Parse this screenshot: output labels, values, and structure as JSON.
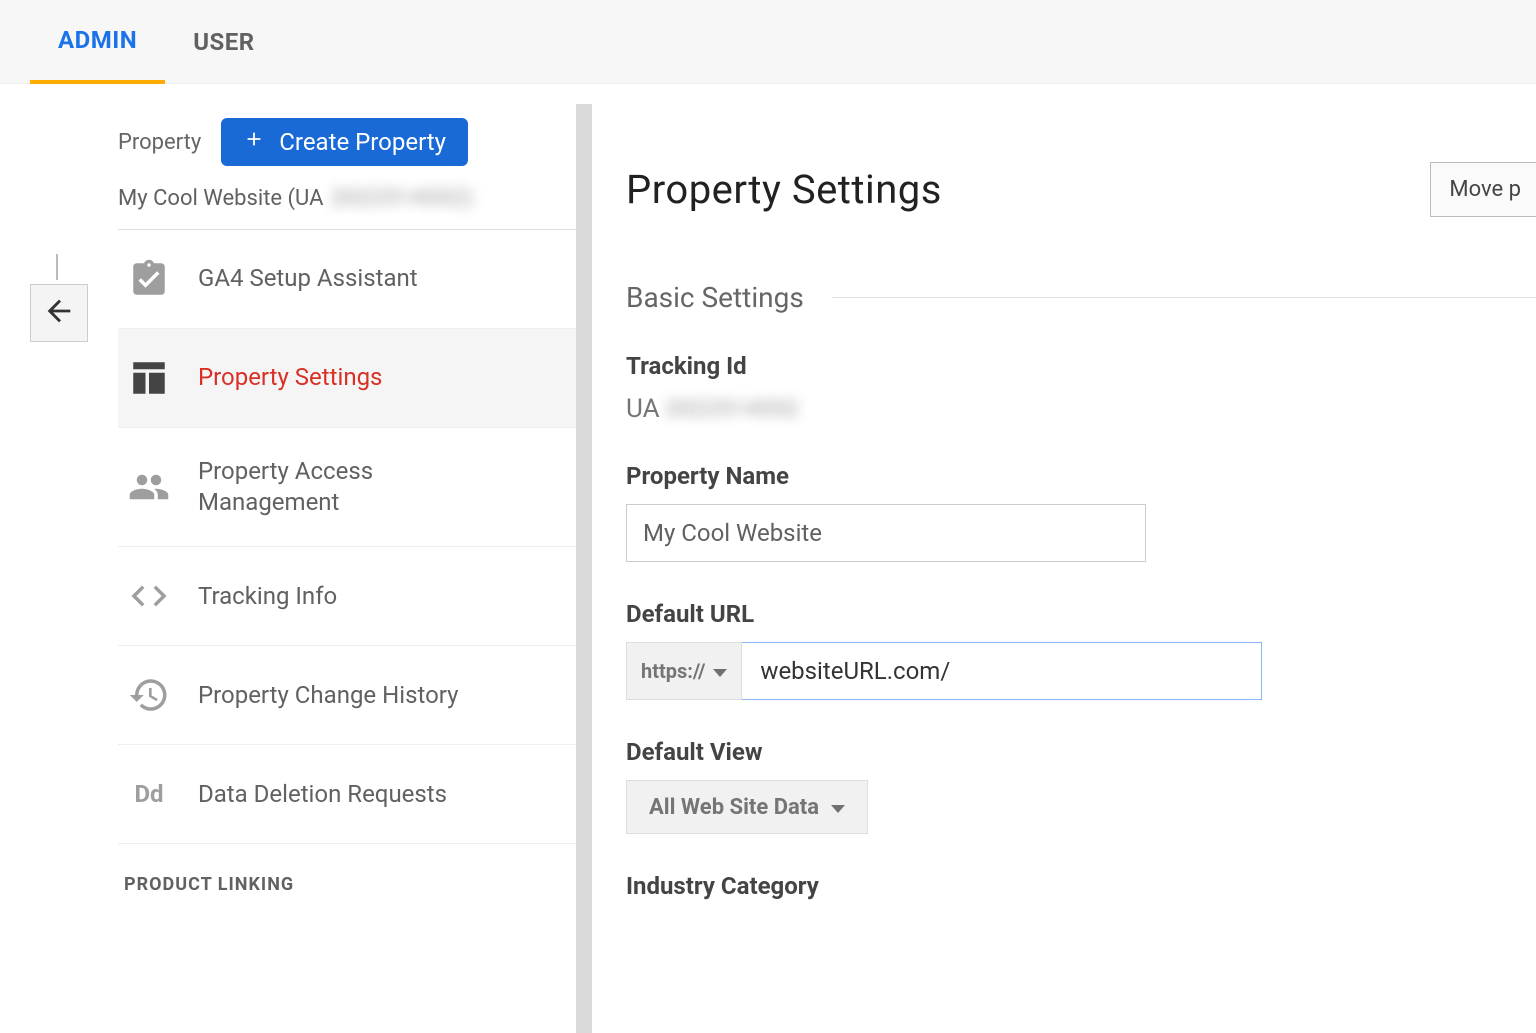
{
  "tabs": {
    "admin": "ADMIN",
    "user": "USER",
    "active": "admin"
  },
  "sidebar": {
    "header_label": "Property",
    "create_button": "Create Property",
    "property_name": "My Cool Website (UA",
    "property_id_obscured": "2022514552)",
    "items": [
      {
        "key": "ga4",
        "label": "GA4 Setup Assistant",
        "icon": "clipboard-check-icon"
      },
      {
        "key": "settings",
        "label": "Property Settings",
        "icon": "layout-icon"
      },
      {
        "key": "access",
        "label": "Property Access Management",
        "icon": "people-icon"
      },
      {
        "key": "tracking",
        "label": "Tracking Info",
        "icon": "code-icon"
      },
      {
        "key": "history",
        "label": "Property Change History",
        "icon": "history-icon"
      },
      {
        "key": "dd",
        "label": "Data Deletion Requests",
        "icon": "dd-icon"
      }
    ],
    "active_key": "settings",
    "section_heading": "PRODUCT LINKING"
  },
  "main": {
    "title": "Property Settings",
    "move_button": "Move p",
    "basic_heading": "Basic Settings",
    "fields": {
      "tracking_id_label": "Tracking Id",
      "tracking_id_prefix": "UA",
      "tracking_id_obscured": "2022514552",
      "property_name_label": "Property Name",
      "property_name_value": "My Cool Website",
      "default_url_label": "Default URL",
      "protocol_value": "https://",
      "url_value": "websiteURL.com/",
      "default_view_label": "Default View",
      "default_view_value": "All Web Site Data",
      "industry_label": "Industry Category"
    }
  }
}
